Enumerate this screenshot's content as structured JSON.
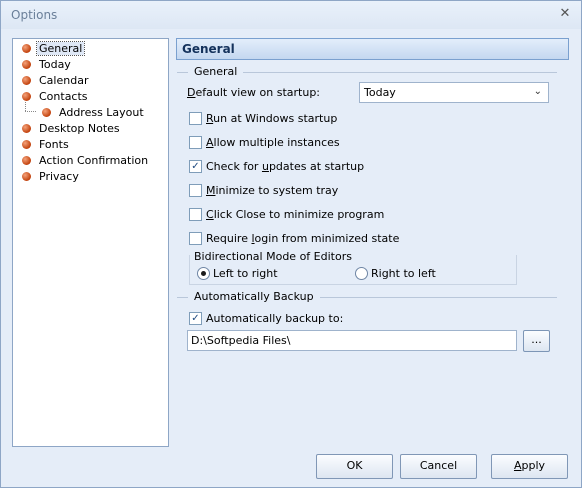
{
  "window": {
    "title": "Options",
    "close_symbol": "✕"
  },
  "tree": {
    "items": [
      {
        "label": "General",
        "selected": true
      },
      {
        "label": "Today"
      },
      {
        "label": "Calendar"
      },
      {
        "label": "Contacts"
      },
      {
        "label": "Address Layout",
        "child": true
      },
      {
        "label": "Desktop Notes"
      },
      {
        "label": "Fonts"
      },
      {
        "label": "Action Confirmation"
      },
      {
        "label": "Privacy"
      }
    ]
  },
  "panel": {
    "header": "General",
    "general_group": "General",
    "default_view_label": "Default view on startup:",
    "default_view_value": "Today",
    "checkboxes": [
      {
        "label": "Run at Windows startup",
        "checked": false
      },
      {
        "label": "Allow multiple instances",
        "checked": false
      },
      {
        "label": "Check for updates at startup",
        "checked": true
      },
      {
        "label": "Minimize to system tray",
        "checked": false
      },
      {
        "label": "Click Close to minimize program",
        "checked": false
      },
      {
        "label": "Require login from minimized state",
        "checked": false
      }
    ],
    "bidi_group": "Bidirectional Mode of Editors",
    "radio_ltr": {
      "label": "Left to right",
      "selected": true
    },
    "radio_rtl": {
      "label": "Right to left",
      "selected": false
    },
    "backup_group": "Automatically Backup",
    "backup_checkbox": {
      "label": "Automatically backup to:",
      "checked": true
    },
    "backup_path": "D:\\Softpedia Files\\",
    "browse_label": "..."
  },
  "buttons": {
    "ok": "OK",
    "cancel": "Cancel",
    "apply": "Apply"
  },
  "icons": {
    "tree_bullet": "orange-ball-icon",
    "combo_arrow": "chevron-down-icon",
    "check": "checkmark-icon"
  }
}
